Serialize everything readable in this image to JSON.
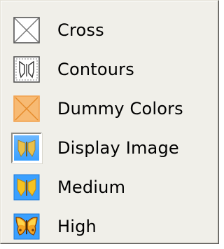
{
  "menu": {
    "items": [
      {
        "label": "Cross",
        "icon": "cross-icon"
      },
      {
        "label": "Contours",
        "icon": "contours-icon"
      },
      {
        "label": "Dummy Colors",
        "icon": "dummy-colors-icon"
      },
      {
        "label": "Display Image",
        "icon": "display-image-icon",
        "selected": true
      },
      {
        "label": "Medium",
        "icon": "medium-icon"
      },
      {
        "label": "High",
        "icon": "high-icon"
      }
    ]
  },
  "colors": {
    "menu_background": "#f0efe9",
    "dummy_orange": "#f7ba73",
    "image_blue": "#3aa0ff",
    "butterfly_yellow": "#f6c320"
  }
}
